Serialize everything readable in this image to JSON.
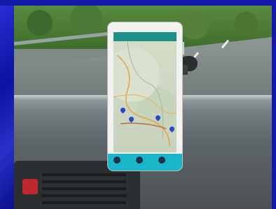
{
  "scene": {
    "description_label": "",
    "phone": {
      "app_bar_text": "",
      "bottom_buttons": [
        {
          "label": "",
          "icon": "circle-button-icon"
        },
        {
          "label": "",
          "icon": "circle-button-icon"
        },
        {
          "label": "",
          "icon": "circle-button-icon"
        }
      ],
      "accent_color": "#1bb6c9",
      "map_pin_color": "#2548c9"
    }
  }
}
